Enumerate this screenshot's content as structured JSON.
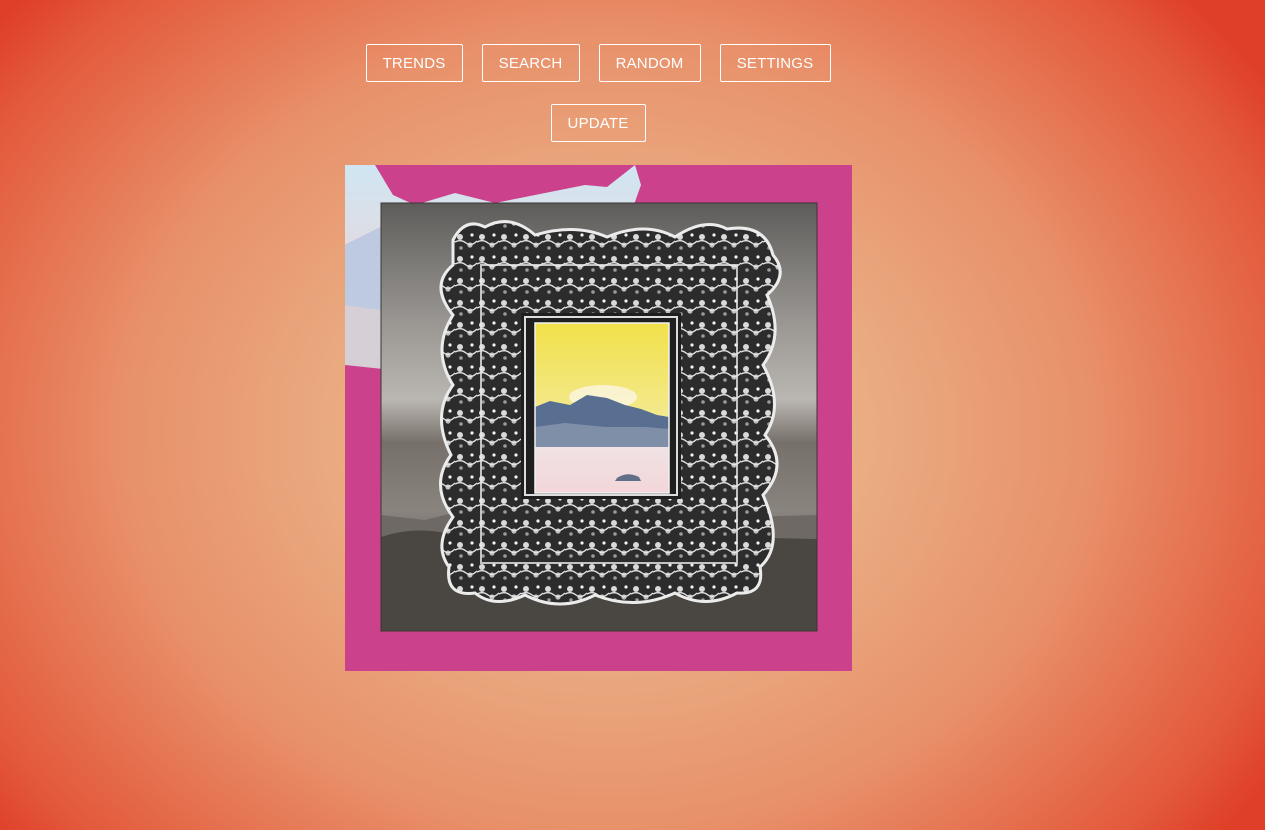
{
  "nav": {
    "trends_label": "TRENDS",
    "search_label": "SEARCH",
    "random_label": "RANDOM",
    "settings_label": "SETTINGS",
    "update_label": "UPDATE"
  },
  "colors": {
    "background_center": "#efbb8f",
    "background_edge": "#df3f28",
    "button_border": "#ffffff",
    "button_text": "#ffffff",
    "artwork_backdrop": "#c93a86"
  },
  "artwork": {
    "icon": "framed-collage-image"
  }
}
